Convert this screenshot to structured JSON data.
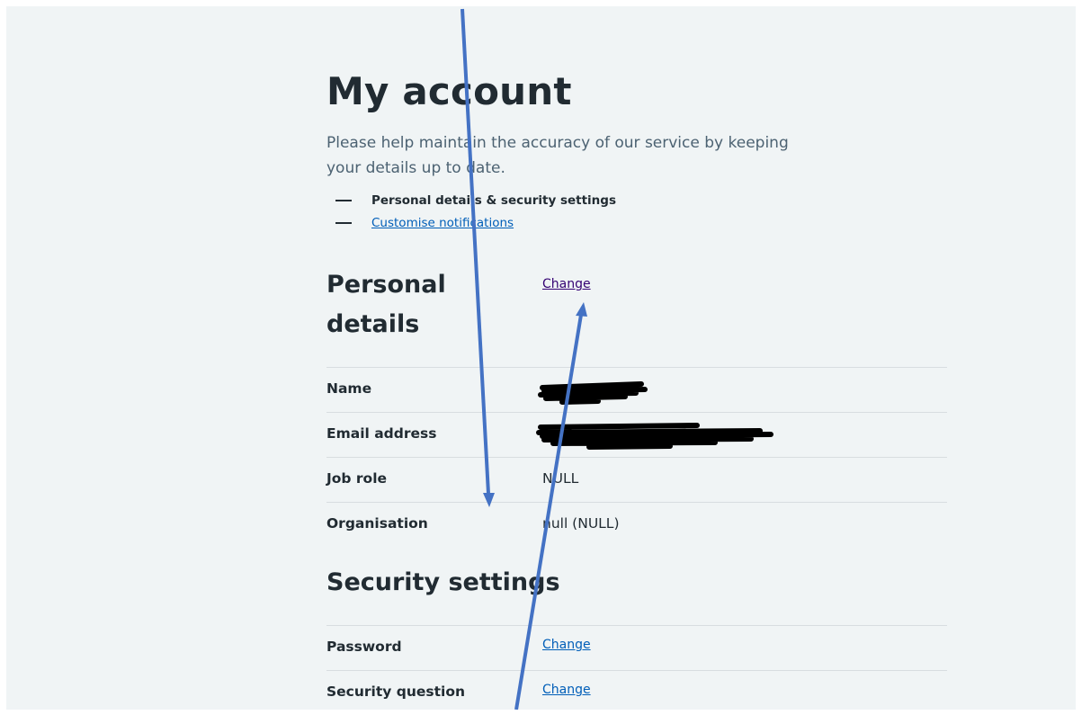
{
  "page": {
    "title": "My account",
    "intro": "Please help maintain the accuracy of our service by keeping your details up to date."
  },
  "contents_list": [
    {
      "label": "Personal details & security settings",
      "current": true
    },
    {
      "label": "Customise notifications",
      "current": false
    }
  ],
  "personal_details": {
    "heading": "Personal details",
    "change_label": "Change",
    "rows": [
      {
        "key": "Name",
        "value": "",
        "redacted": true
      },
      {
        "key": "Email address",
        "value": "",
        "redacted": true
      },
      {
        "key": "Job role",
        "value": "NULL"
      },
      {
        "key": "Organisation",
        "value": "null (NULL)"
      }
    ]
  },
  "security_settings": {
    "heading": "Security settings",
    "rows": [
      {
        "key": "Password",
        "link": "Change"
      },
      {
        "key": "Security question",
        "link": "Change"
      }
    ]
  },
  "colors": {
    "background": "#f0f4f5",
    "text": "#212b32",
    "secondary_text": "#4c6272",
    "link": "#005eb8",
    "visited_link": "#330072",
    "annotation_arrow": "#4472c4",
    "redaction": "#000000"
  }
}
